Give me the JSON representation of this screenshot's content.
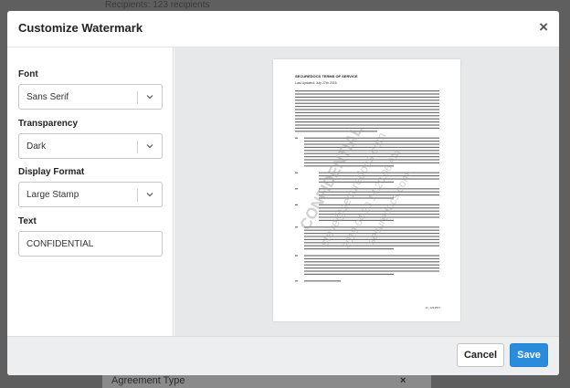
{
  "background": {
    "top_text": "Recipients: 123 recipients",
    "bottom_field_label": "Agreement Type",
    "bottom_field_clear": "×"
  },
  "modal": {
    "title": "Customize Watermark",
    "close_glyph": "×"
  },
  "form": {
    "font": {
      "label": "Font",
      "value": "Sans Serif"
    },
    "transparency": {
      "label": "Transparency",
      "value": "Dark"
    },
    "display_format": {
      "label": "Display Format",
      "value": "Large Stamp"
    },
    "text": {
      "label": "Text",
      "value": "CONFIDENTIAL"
    }
  },
  "preview": {
    "doc_title": "SECUREDOCS TERMS OF SERVICE",
    "doc_date": "Last Updated: July 27th 2016",
    "doc_footer": "12_1234567",
    "watermark_text": "CONFIDENTIAL",
    "watermark_lines": [
      "CONFIDENTIAL",
      "steve@securedocs.com",
      "2019-04-23 14:20:06 AM",
      "securedocs.com"
    ]
  },
  "footer": {
    "cancel_label": "Cancel",
    "save_label": "Save"
  },
  "colors": {
    "accent": "#2b8cde",
    "preview_bg": "#e6e8ea"
  }
}
